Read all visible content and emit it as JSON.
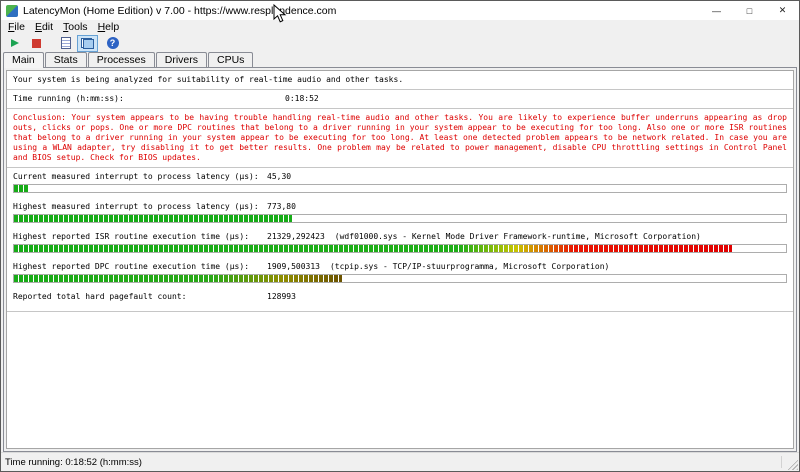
{
  "window": {
    "title": "LatencyMon  (Home Edition)  v 7.00  - https://www.resplendence.com",
    "controls": [
      {
        "name": "minimize",
        "glyph": "—"
      },
      {
        "name": "maximize",
        "glyph": "□"
      },
      {
        "name": "close",
        "glyph": "✕"
      }
    ]
  },
  "menu": {
    "items": [
      "File",
      "Edit",
      "Tools",
      "Help"
    ]
  },
  "toolbar": {
    "buttons": [
      {
        "name": "start-monitor",
        "icon": "play-icon",
        "pressed": false
      },
      {
        "name": "stop-monitor",
        "icon": "stop-icon",
        "pressed": false
      },
      {
        "name": "copy-report",
        "icon": "report-icon",
        "pressed": false
      },
      {
        "name": "capture-window",
        "icon": "windows-icon",
        "pressed": true
      },
      {
        "name": "help",
        "icon": "help-icon",
        "pressed": false
      }
    ]
  },
  "tabs": {
    "active": "Main",
    "items": [
      "Main",
      "Stats",
      "Processes",
      "Drivers",
      "CPUs"
    ]
  },
  "report": {
    "analysis_line": "Your system is being analyzed for suitability of real-time audio and other tasks.",
    "time_label": "Time running (h:mm:ss):",
    "time_value": "0:18:52",
    "conclusion": "Conclusion: Your system appears to be having trouble handling real-time audio and other tasks. You are likely to experience buffer underruns appearing as drop outs, clicks or pops. One or more DPC routines that belong to a driver running in your system appear to be executing for too long. Also one or more ISR routines that belong to a driver running in your system appear to be executing for too long. At least one detected problem appears to be network related. In case you are using a WLAN adapter, try disabling it to get better results. One problem may be related to power management, disable CPU throttling settings in Control Panel and BIOS setup. Check for BIOS updates.",
    "conclusion_color": "#dd0000",
    "bar_green": "#17ac17",
    "bar_red": "#e00000",
    "metrics": [
      {
        "label": "Current measured interrupt to process latency (µs):",
        "value": "45,30",
        "note": "",
        "bar": {
          "percent": 1.8,
          "stops": [
            "#17ac17 0%",
            "#17ac17 100%"
          ]
        }
      },
      {
        "label": "Highest measured interrupt to process latency (µs):",
        "value": "773,80",
        "note": "",
        "bar": {
          "percent": 36,
          "stops": [
            "#17ac17 0%",
            "#17ac17 100%"
          ]
        }
      },
      {
        "label": "Highest reported ISR routine execution time (µs):",
        "value": "21329,292423",
        "note": "(wdf01000.sys - Kernel Mode Driver Framework-runtime, Microsoft Corporation)",
        "bar": {
          "percent": 93,
          "stops": [
            "#17ac17 0%",
            "#1fae17 62%",
            "#c8c400 70%",
            "#e81400 78%",
            "#e00000 100%"
          ]
        }
      },
      {
        "label": "Highest reported DPC routine execution time (µs):",
        "value": "1909,500313",
        "note": "(tcpip.sys - TCP/IP-stuurprogramma, Microsoft Corporation)",
        "bar": {
          "percent": 42.5,
          "stops": [
            "#17ac17 0%",
            "#2aa817 60%",
            "#8f8d00 82%",
            "#6b5200 100%"
          ]
        }
      },
      {
        "label": "Reported total hard pagefault count:",
        "value": "128993",
        "note": "",
        "bar": null
      }
    ]
  },
  "statusbar": {
    "text": "Time running: 0:18:52  (h:mm:ss)"
  }
}
